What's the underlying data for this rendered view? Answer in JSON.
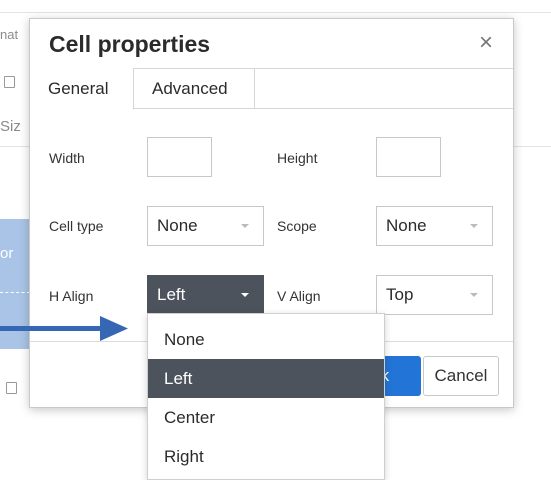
{
  "background": {
    "fragment_top": "nat",
    "fragment_size": "Siz",
    "fragment_mid": "or"
  },
  "dialog": {
    "title": "Cell properties",
    "close_icon": "close-icon",
    "tabs": [
      {
        "label": "General",
        "active": true
      },
      {
        "label": "Advanced",
        "active": false
      }
    ],
    "fields": {
      "width_label": "Width",
      "width_value": "",
      "height_label": "Height",
      "height_value": "",
      "cell_type_label": "Cell type",
      "cell_type_value": "None",
      "scope_label": "Scope",
      "scope_value": "None",
      "h_align_label": "H Align",
      "h_align_value": "Left",
      "v_align_label": "V Align",
      "v_align_value": "Top"
    },
    "buttons": {
      "ok_label": "Ok",
      "ok_visible_text": ")k",
      "cancel_label": "Cancel"
    }
  },
  "dropdown": {
    "items": [
      "None",
      "Left",
      "Center",
      "Right"
    ],
    "selected": "Left"
  },
  "colors": {
    "accent": "#2275d7",
    "selected_bg": "#4c535c",
    "arrow": "#3567b5"
  }
}
